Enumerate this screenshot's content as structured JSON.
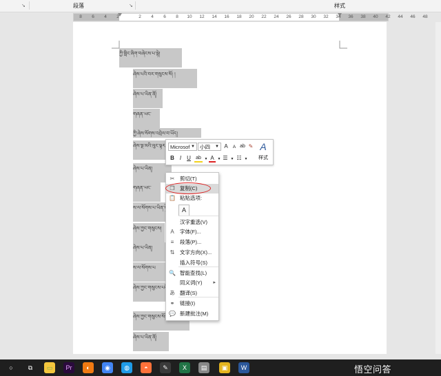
{
  "ribbon": {
    "group_paragraph": "段落",
    "group_styles": "样式"
  },
  "ruler": {
    "ticks": [
      "8",
      "6",
      "4",
      "2",
      "2",
      "4",
      "6",
      "8",
      "10",
      "12",
      "14",
      "16",
      "18",
      "20",
      "22",
      "24",
      "26",
      "28",
      "30",
      "32",
      "34",
      "36",
      "38",
      "40",
      "42",
      "44",
      "46",
      "48"
    ]
  },
  "document": {
    "lines": [
      "ཀྱི་གླིང་ཞིག་བཞེངས་པ་སྟེ།",
      "ཞེས་པའི་བར་གསུངས་སོ། །",
      "ཞེས་པ་ཡིན་ནོ།",
      "གཞན་ཡང་",
      "ཀྱི་ཞེས་སོགས་འབྲེལ་བ་ཡོད།",
      "ཞེས་སྔ་མའི་ལུང་ལྟར་ཡིན།",
      "ཞེས་པ་ཡིན།",
      "གཞན་ཡང་",
      "ས་ལ་སོགས་པ་ཡིན་ཏེ།",
      "ཞེས་ཀྱང་གསུངས།",
      "ཞེས་པ་ཡིན།",
      "ས་ལ་སོགས་པ",
      "ཞེས་ཀྱང་གསུངས་པའི་ཕྱིར།",
      "ཞེས་ཀྱང་གསུངས་སོ།",
      "ཞེས་པ་ཡིན་ནོ།"
    ]
  },
  "mini_toolbar": {
    "font_name": "Microsof",
    "font_size": "小四",
    "bold": "B",
    "italic": "I",
    "underline": "U",
    "grow_font": "A",
    "shrink_font": "A",
    "font_color": "A",
    "styles_label": "样式"
  },
  "context_menu": {
    "items": [
      {
        "label": "剪切(T)",
        "icon": "scissors-icon"
      },
      {
        "label": "复制(C)",
        "icon": "copy-icon"
      },
      {
        "label": "粘贴选项:",
        "icon": "clipboard-icon"
      },
      {
        "label": "汉字重选(V)",
        "icon": ""
      },
      {
        "label": "字体(F)...",
        "icon": "font-icon"
      },
      {
        "label": "段落(P)...",
        "icon": "paragraph-icon"
      },
      {
        "label": "文字方向(X)...",
        "icon": "text-direction-icon"
      },
      {
        "label": "插入符号(S)",
        "icon": ""
      },
      {
        "label": "智能查找(L)",
        "icon": "search-icon"
      },
      {
        "label": "同义词(Y)",
        "icon": ""
      },
      {
        "label": "翻译(S)",
        "icon": "translate-icon"
      },
      {
        "label": "链接(I)",
        "icon": "link-icon"
      },
      {
        "label": "新建批注(M)",
        "icon": "comment-icon"
      }
    ],
    "paste_glyph": "A"
  },
  "taskbar": {
    "watermark": "悟空问答",
    "apps": [
      "start",
      "task-view",
      "file-explorer",
      "premiere",
      "app-orange",
      "chrome",
      "app-blue",
      "firefox",
      "app-pen",
      "excel",
      "app-gray",
      "app-yellow",
      "word"
    ]
  },
  "colors": {
    "highlight": "#c8c8c8",
    "annotation": "#d22222",
    "word_blue": "#2b579a",
    "excel_green": "#217346"
  }
}
